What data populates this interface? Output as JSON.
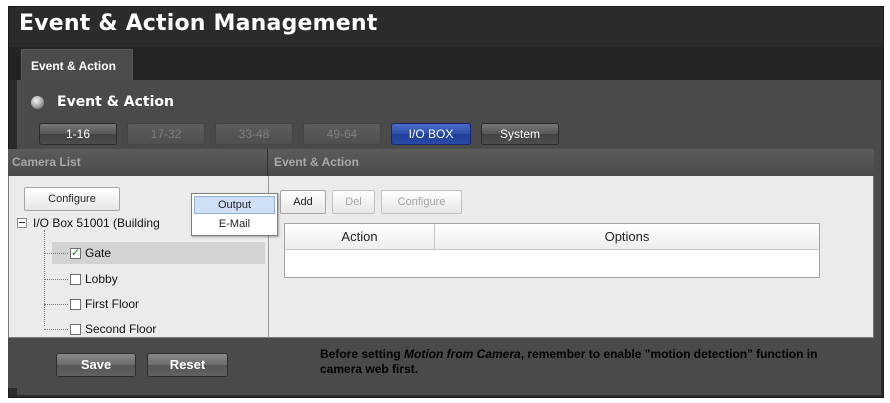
{
  "app": {
    "title": "Event & Action Management"
  },
  "tabs": [
    {
      "label": "Event & Action",
      "active": true
    }
  ],
  "section": {
    "title": "Event & Action"
  },
  "filters": [
    {
      "label": "1-16",
      "state": "normal"
    },
    {
      "label": "17-32",
      "state": "disabled"
    },
    {
      "label": "33-48",
      "state": "disabled"
    },
    {
      "label": "49-64",
      "state": "disabled"
    },
    {
      "label": "I/O BOX",
      "state": "selected"
    },
    {
      "label": "System",
      "state": "normal"
    }
  ],
  "camera_list": {
    "header": "Camera List",
    "configure_label": "Configure",
    "root": {
      "label": "I/O Box 51001 (Building",
      "expanded": true
    },
    "items": [
      {
        "label": "Gate",
        "checked": true,
        "selected": true
      },
      {
        "label": "Lobby",
        "checked": false,
        "selected": false
      },
      {
        "label": "First Floor",
        "checked": false,
        "selected": false
      },
      {
        "label": "Second Floor",
        "checked": false,
        "selected": false
      }
    ]
  },
  "dropdown": {
    "items": [
      {
        "label": "Output",
        "highlighted": true
      },
      {
        "label": "E-Mail",
        "highlighted": false
      }
    ]
  },
  "event_action": {
    "header": "Event & Action",
    "add_label": "Add",
    "del_label": "Del",
    "configure_label": "Configure",
    "columns": [
      "Action",
      "Options"
    ]
  },
  "footer": {
    "save_label": "Save",
    "reset_label": "Reset",
    "note_prefix": "Before setting ",
    "note_italic": "Motion from Camera",
    "note_suffix": ", remember to enable \"motion detection\" function in camera web first."
  },
  "colors": {
    "selected_filter": "#2d4ea8",
    "panel_bg": "#4a4a4a",
    "content_bg": "#ebebeb"
  }
}
